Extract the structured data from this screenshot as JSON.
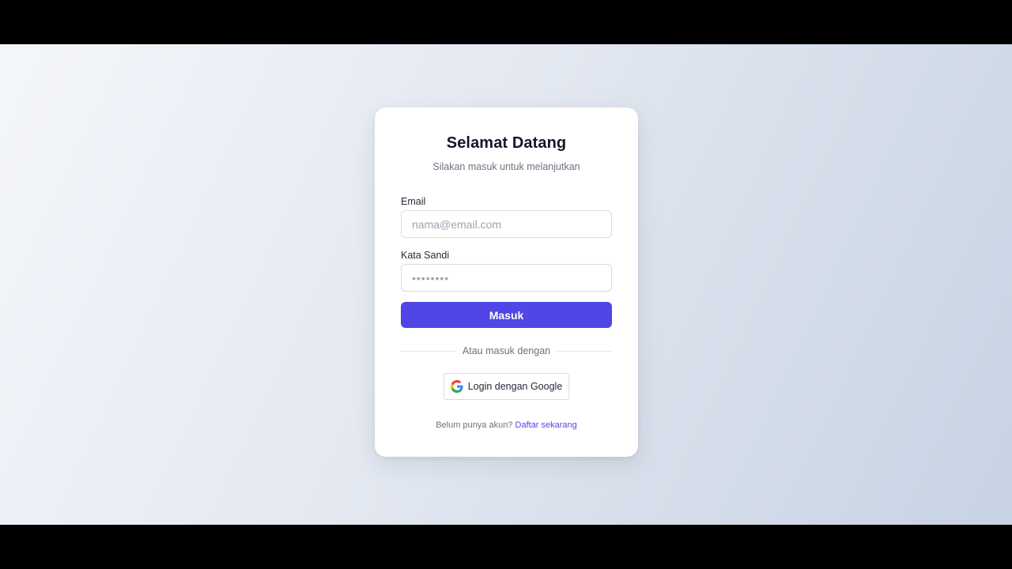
{
  "login": {
    "title": "Selamat Datang",
    "subtitle": "Silakan masuk untuk melanjutkan",
    "email_label": "Email",
    "email_placeholder": "nama@email.com",
    "email_value": "",
    "password_label": "Kata Sandi",
    "password_placeholder": "••••••••",
    "password_value": "",
    "submit_label": "Masuk",
    "divider_text": "Atau masuk dengan",
    "google_label": "Login dengan Google",
    "footer_text": "Belum punya akun?",
    "signup_link": "Daftar sekarang"
  },
  "colors": {
    "accent": "#4f46e5",
    "title": "#111827",
    "muted": "#6b7280",
    "card": "#ffffff"
  },
  "icons": {
    "google": "google-icon"
  }
}
